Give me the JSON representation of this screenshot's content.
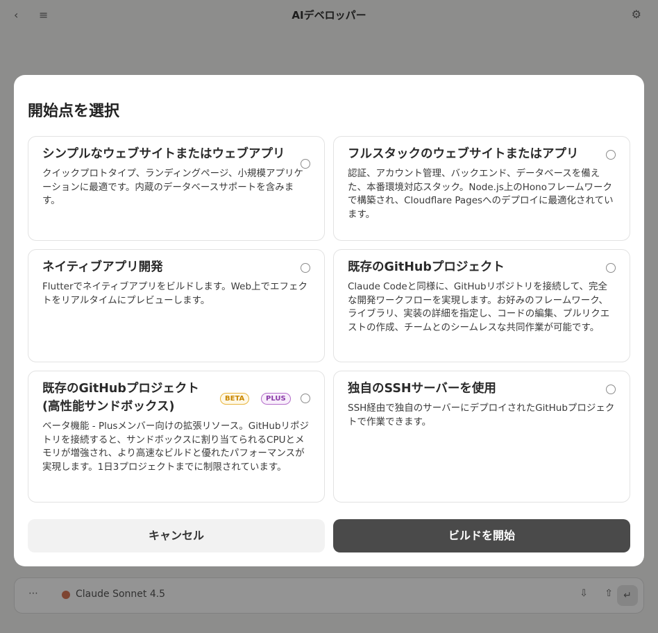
{
  "background": {
    "back_icon": "chevron-left-icon",
    "back_glyph": "‹",
    "menu_icon": "list-icon",
    "menu_glyph": "≡",
    "title": "AIデベロッパー",
    "settings_icon": "gear-icon",
    "settings_glyph": "⚙",
    "composer": {
      "more_glyph": "⋯",
      "model": "Claude Sonnet 4.5",
      "icon_a": "⇩",
      "icon_b": "⇧",
      "send_glyph": "↵"
    }
  },
  "modal": {
    "title": "開始点を選択",
    "options": [
      {
        "title": "シンプルなウェブサイトまたはウェブアプリ",
        "description": "クイックプロトタイプ、ランディングページ、小規模アプリケーションに最適です。内蔵のデータベースサポートを含みます。"
      },
      {
        "title": "フルスタックのウェブサイトまたはアプリ",
        "description": "認証、アカウント管理、バックエンド、データベースを備えた、本番環境対応スタック。Node.js上のHonoフレームワークで構築され、Cloudflare Pagesへのデプロイに最適化されています。"
      },
      {
        "title": "ネイティブアプリ開発",
        "description": "Flutterでネイティブアプリをビルドします。Web上でエフェクトをリアルタイムにプレビューします。"
      },
      {
        "title": "既存のGitHubプロジェクト",
        "description": "Claude Codeと同様に、GitHubリポジトリを接続して、完全な開発ワークフローを実現します。お好みのフレームワーク、ライブラリ、実装の詳細を指定し、コードの編集、プルリクエストの作成、チームとのシームレスな共同作業が可能です。"
      },
      {
        "title": "既存のGitHubプロジェクト(高性能サンドボックス)",
        "badges": [
          "BETA",
          "PLUS"
        ],
        "description": "ベータ機能 - Plusメンバー向けの拡張リソース。GitHubリポジトリを接続すると、サンドボックスに割り当てられるCPUとメモリが増強され、より高速なビルドと優れたパフォーマンスが実現します。1日3プロジェクトまでに制限されています。"
      },
      {
        "title": "独自のSSHサーバーを使用",
        "description": "SSH経由で独自のサーバーにデプロイされたGitHubプロジェクトで作業できます。"
      }
    ],
    "cancel_label": "キャンセル",
    "start_label": "ビルドを開始"
  }
}
